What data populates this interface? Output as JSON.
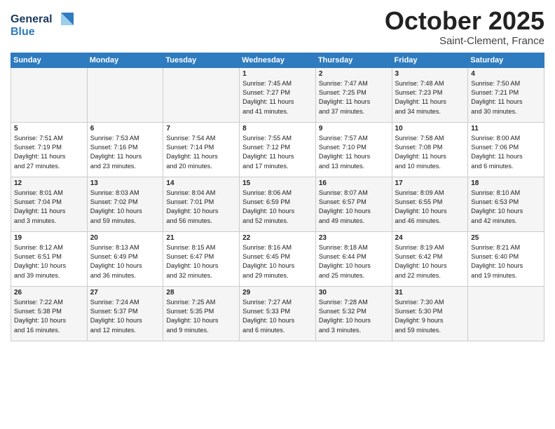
{
  "header": {
    "logo_line1": "General",
    "logo_line2": "Blue",
    "month": "October 2025",
    "location": "Saint-Clement, France"
  },
  "weekdays": [
    "Sunday",
    "Monday",
    "Tuesday",
    "Wednesday",
    "Thursday",
    "Friday",
    "Saturday"
  ],
  "rows": [
    [
      {
        "day": "",
        "info": ""
      },
      {
        "day": "",
        "info": ""
      },
      {
        "day": "",
        "info": ""
      },
      {
        "day": "1",
        "info": "Sunrise: 7:45 AM\nSunset: 7:27 PM\nDaylight: 11 hours\nand 41 minutes."
      },
      {
        "day": "2",
        "info": "Sunrise: 7:47 AM\nSunset: 7:25 PM\nDaylight: 11 hours\nand 37 minutes."
      },
      {
        "day": "3",
        "info": "Sunrise: 7:48 AM\nSunset: 7:23 PM\nDaylight: 11 hours\nand 34 minutes."
      },
      {
        "day": "4",
        "info": "Sunrise: 7:50 AM\nSunset: 7:21 PM\nDaylight: 11 hours\nand 30 minutes."
      }
    ],
    [
      {
        "day": "5",
        "info": "Sunrise: 7:51 AM\nSunset: 7:19 PM\nDaylight: 11 hours\nand 27 minutes."
      },
      {
        "day": "6",
        "info": "Sunrise: 7:53 AM\nSunset: 7:16 PM\nDaylight: 11 hours\nand 23 minutes."
      },
      {
        "day": "7",
        "info": "Sunrise: 7:54 AM\nSunset: 7:14 PM\nDaylight: 11 hours\nand 20 minutes."
      },
      {
        "day": "8",
        "info": "Sunrise: 7:55 AM\nSunset: 7:12 PM\nDaylight: 11 hours\nand 17 minutes."
      },
      {
        "day": "9",
        "info": "Sunrise: 7:57 AM\nSunset: 7:10 PM\nDaylight: 11 hours\nand 13 minutes."
      },
      {
        "day": "10",
        "info": "Sunrise: 7:58 AM\nSunset: 7:08 PM\nDaylight: 11 hours\nand 10 minutes."
      },
      {
        "day": "11",
        "info": "Sunrise: 8:00 AM\nSunset: 7:06 PM\nDaylight: 11 hours\nand 6 minutes."
      }
    ],
    [
      {
        "day": "12",
        "info": "Sunrise: 8:01 AM\nSunset: 7:04 PM\nDaylight: 11 hours\nand 3 minutes."
      },
      {
        "day": "13",
        "info": "Sunrise: 8:03 AM\nSunset: 7:02 PM\nDaylight: 10 hours\nand 59 minutes."
      },
      {
        "day": "14",
        "info": "Sunrise: 8:04 AM\nSunset: 7:01 PM\nDaylight: 10 hours\nand 56 minutes."
      },
      {
        "day": "15",
        "info": "Sunrise: 8:06 AM\nSunset: 6:59 PM\nDaylight: 10 hours\nand 52 minutes."
      },
      {
        "day": "16",
        "info": "Sunrise: 8:07 AM\nSunset: 6:57 PM\nDaylight: 10 hours\nand 49 minutes."
      },
      {
        "day": "17",
        "info": "Sunrise: 8:09 AM\nSunset: 6:55 PM\nDaylight: 10 hours\nand 46 minutes."
      },
      {
        "day": "18",
        "info": "Sunrise: 8:10 AM\nSunset: 6:53 PM\nDaylight: 10 hours\nand 42 minutes."
      }
    ],
    [
      {
        "day": "19",
        "info": "Sunrise: 8:12 AM\nSunset: 6:51 PM\nDaylight: 10 hours\nand 39 minutes."
      },
      {
        "day": "20",
        "info": "Sunrise: 8:13 AM\nSunset: 6:49 PM\nDaylight: 10 hours\nand 36 minutes."
      },
      {
        "day": "21",
        "info": "Sunrise: 8:15 AM\nSunset: 6:47 PM\nDaylight: 10 hours\nand 32 minutes."
      },
      {
        "day": "22",
        "info": "Sunrise: 8:16 AM\nSunset: 6:45 PM\nDaylight: 10 hours\nand 29 minutes."
      },
      {
        "day": "23",
        "info": "Sunrise: 8:18 AM\nSunset: 6:44 PM\nDaylight: 10 hours\nand 25 minutes."
      },
      {
        "day": "24",
        "info": "Sunrise: 8:19 AM\nSunset: 6:42 PM\nDaylight: 10 hours\nand 22 minutes."
      },
      {
        "day": "25",
        "info": "Sunrise: 8:21 AM\nSunset: 6:40 PM\nDaylight: 10 hours\nand 19 minutes."
      }
    ],
    [
      {
        "day": "26",
        "info": "Sunrise: 7:22 AM\nSunset: 5:38 PM\nDaylight: 10 hours\nand 16 minutes."
      },
      {
        "day": "27",
        "info": "Sunrise: 7:24 AM\nSunset: 5:37 PM\nDaylight: 10 hours\nand 12 minutes."
      },
      {
        "day": "28",
        "info": "Sunrise: 7:25 AM\nSunset: 5:35 PM\nDaylight: 10 hours\nand 9 minutes."
      },
      {
        "day": "29",
        "info": "Sunrise: 7:27 AM\nSunset: 5:33 PM\nDaylight: 10 hours\nand 6 minutes."
      },
      {
        "day": "30",
        "info": "Sunrise: 7:28 AM\nSunset: 5:32 PM\nDaylight: 10 hours\nand 3 minutes."
      },
      {
        "day": "31",
        "info": "Sunrise: 7:30 AM\nSunset: 5:30 PM\nDaylight: 9 hours\nand 59 minutes."
      },
      {
        "day": "",
        "info": ""
      }
    ]
  ]
}
